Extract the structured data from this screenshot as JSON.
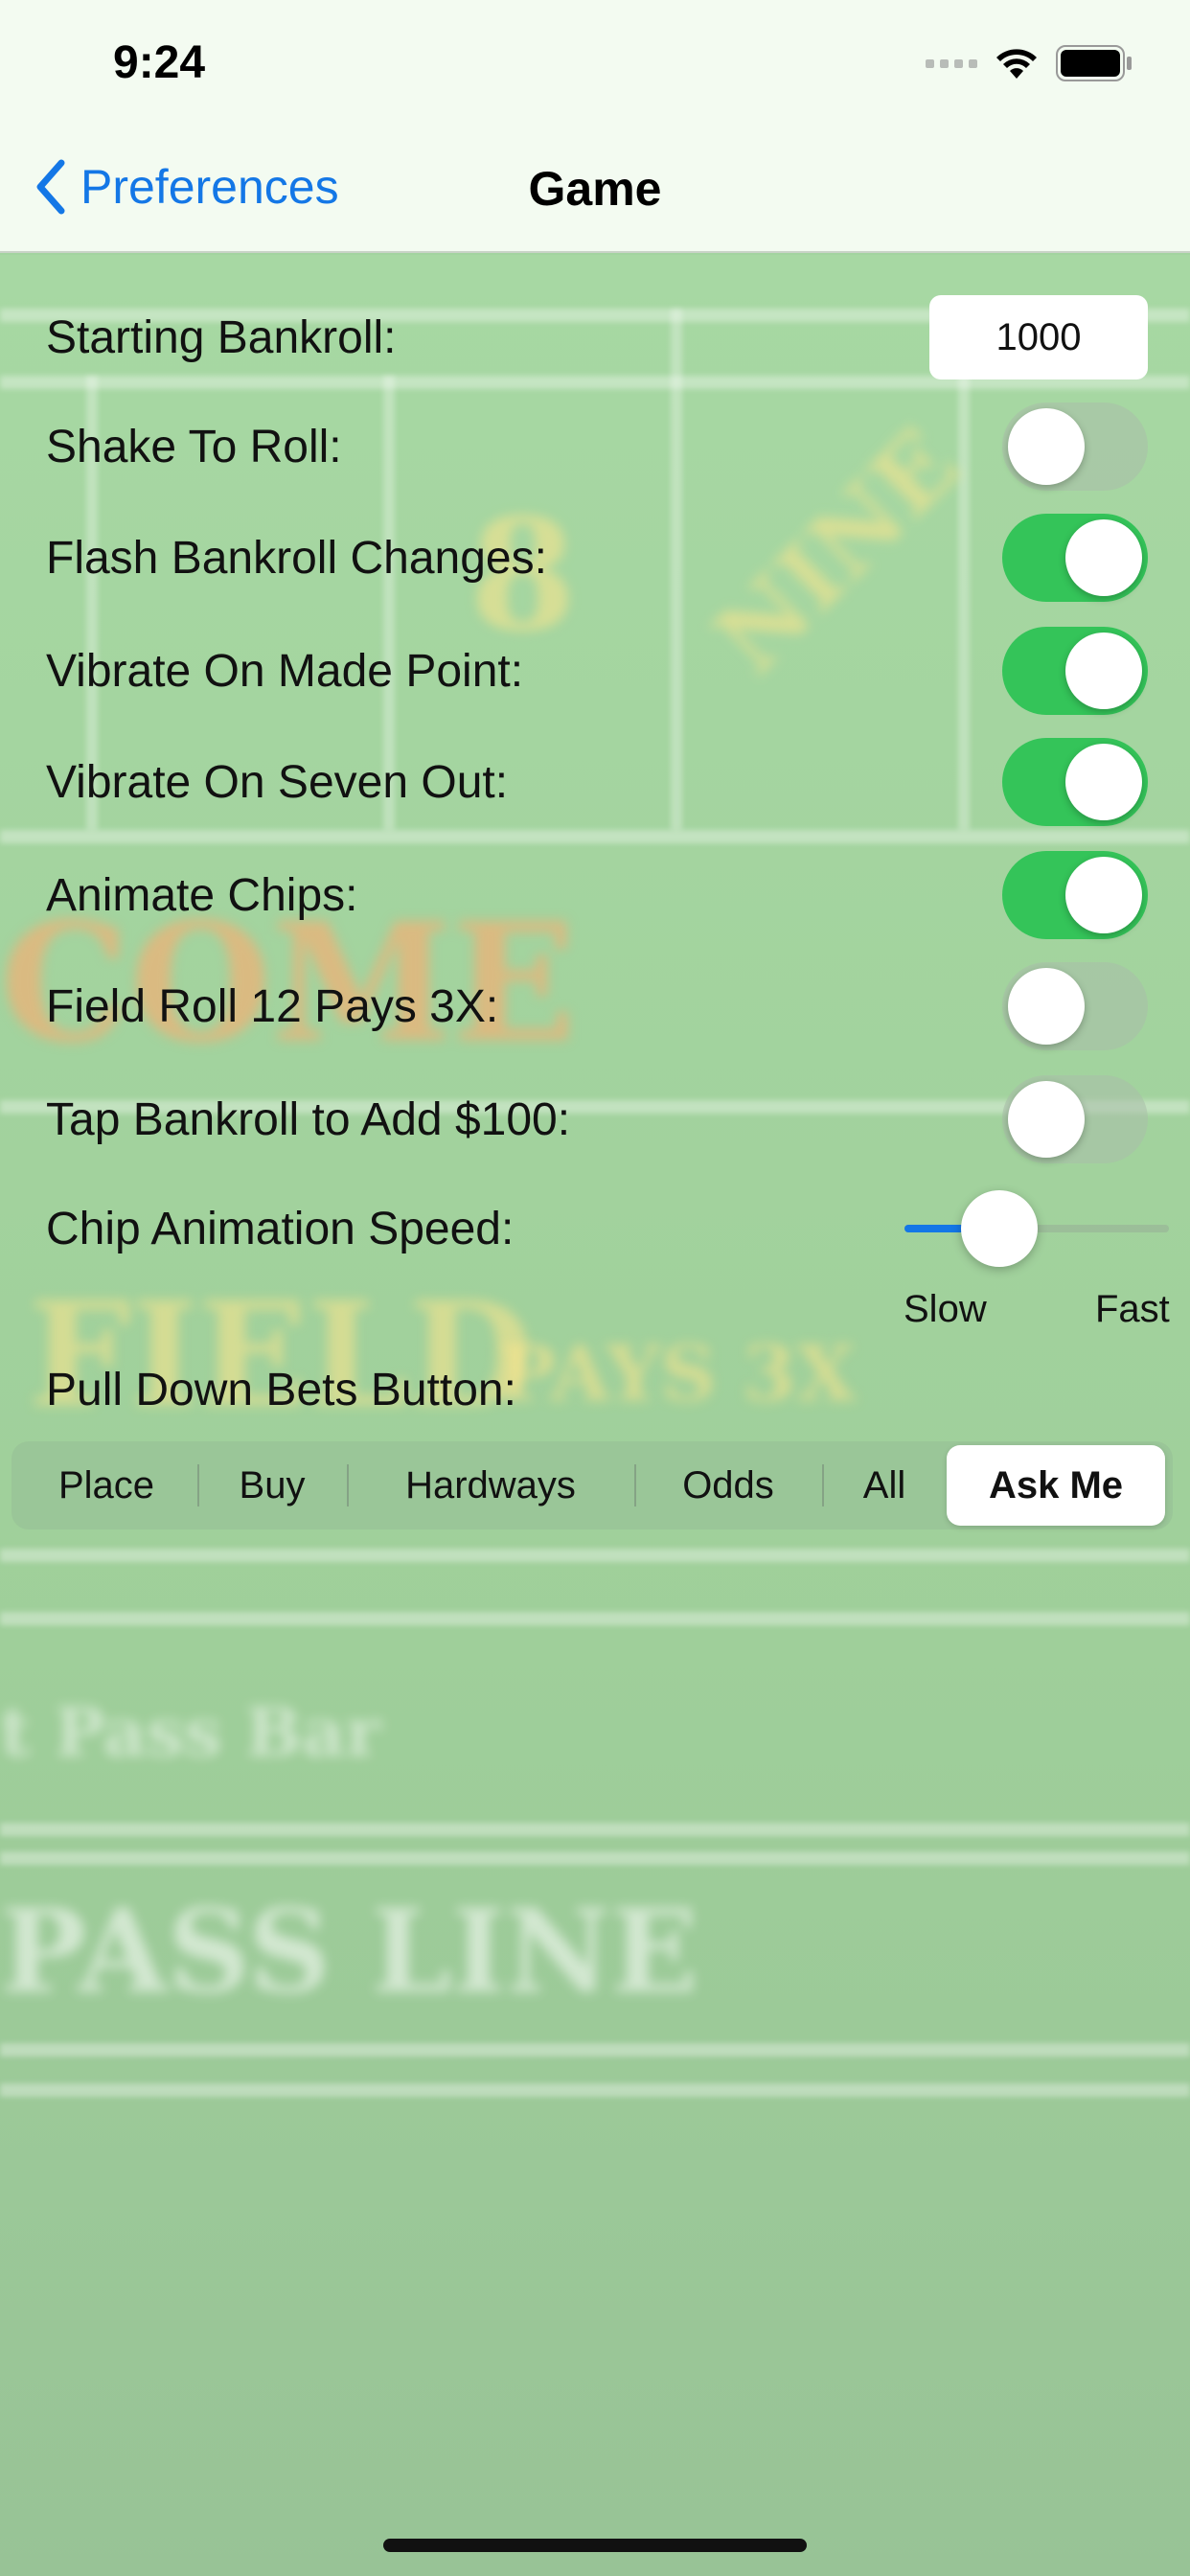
{
  "status_bar": {
    "time": "9:24"
  },
  "nav": {
    "back_label": "Preferences",
    "title": "Game"
  },
  "settings": {
    "starting_bankroll": {
      "label": "Starting Bankroll:",
      "value": "1000"
    },
    "shake_to_roll": {
      "label": "Shake To Roll:",
      "on": false
    },
    "flash_bankroll": {
      "label": "Flash Bankroll Changes:",
      "on": true
    },
    "vibrate_made_point": {
      "label": "Vibrate On Made Point:",
      "on": true
    },
    "vibrate_seven_out": {
      "label": "Vibrate On Seven Out:",
      "on": true
    },
    "animate_chips": {
      "label": "Animate Chips:",
      "on": true
    },
    "field_roll_12": {
      "label": "Field Roll 12 Pays 3X:",
      "on": false
    },
    "tap_bankroll": {
      "label": "Tap Bankroll to Add $100:",
      "on": false
    },
    "chip_speed": {
      "label": "Chip Animation Speed:",
      "value": 0.3,
      "min_label": "Slow",
      "max_label": "Fast"
    },
    "pull_down": {
      "label": "Pull Down Bets Button:",
      "options": [
        "Place",
        "Buy",
        "Hardways",
        "Odds",
        "All",
        "Ask Me"
      ],
      "selected": "Ask Me"
    }
  },
  "colors": {
    "accent": "#1477e6",
    "toggle_on": "#34c459",
    "felt": "#a3d4a0"
  }
}
